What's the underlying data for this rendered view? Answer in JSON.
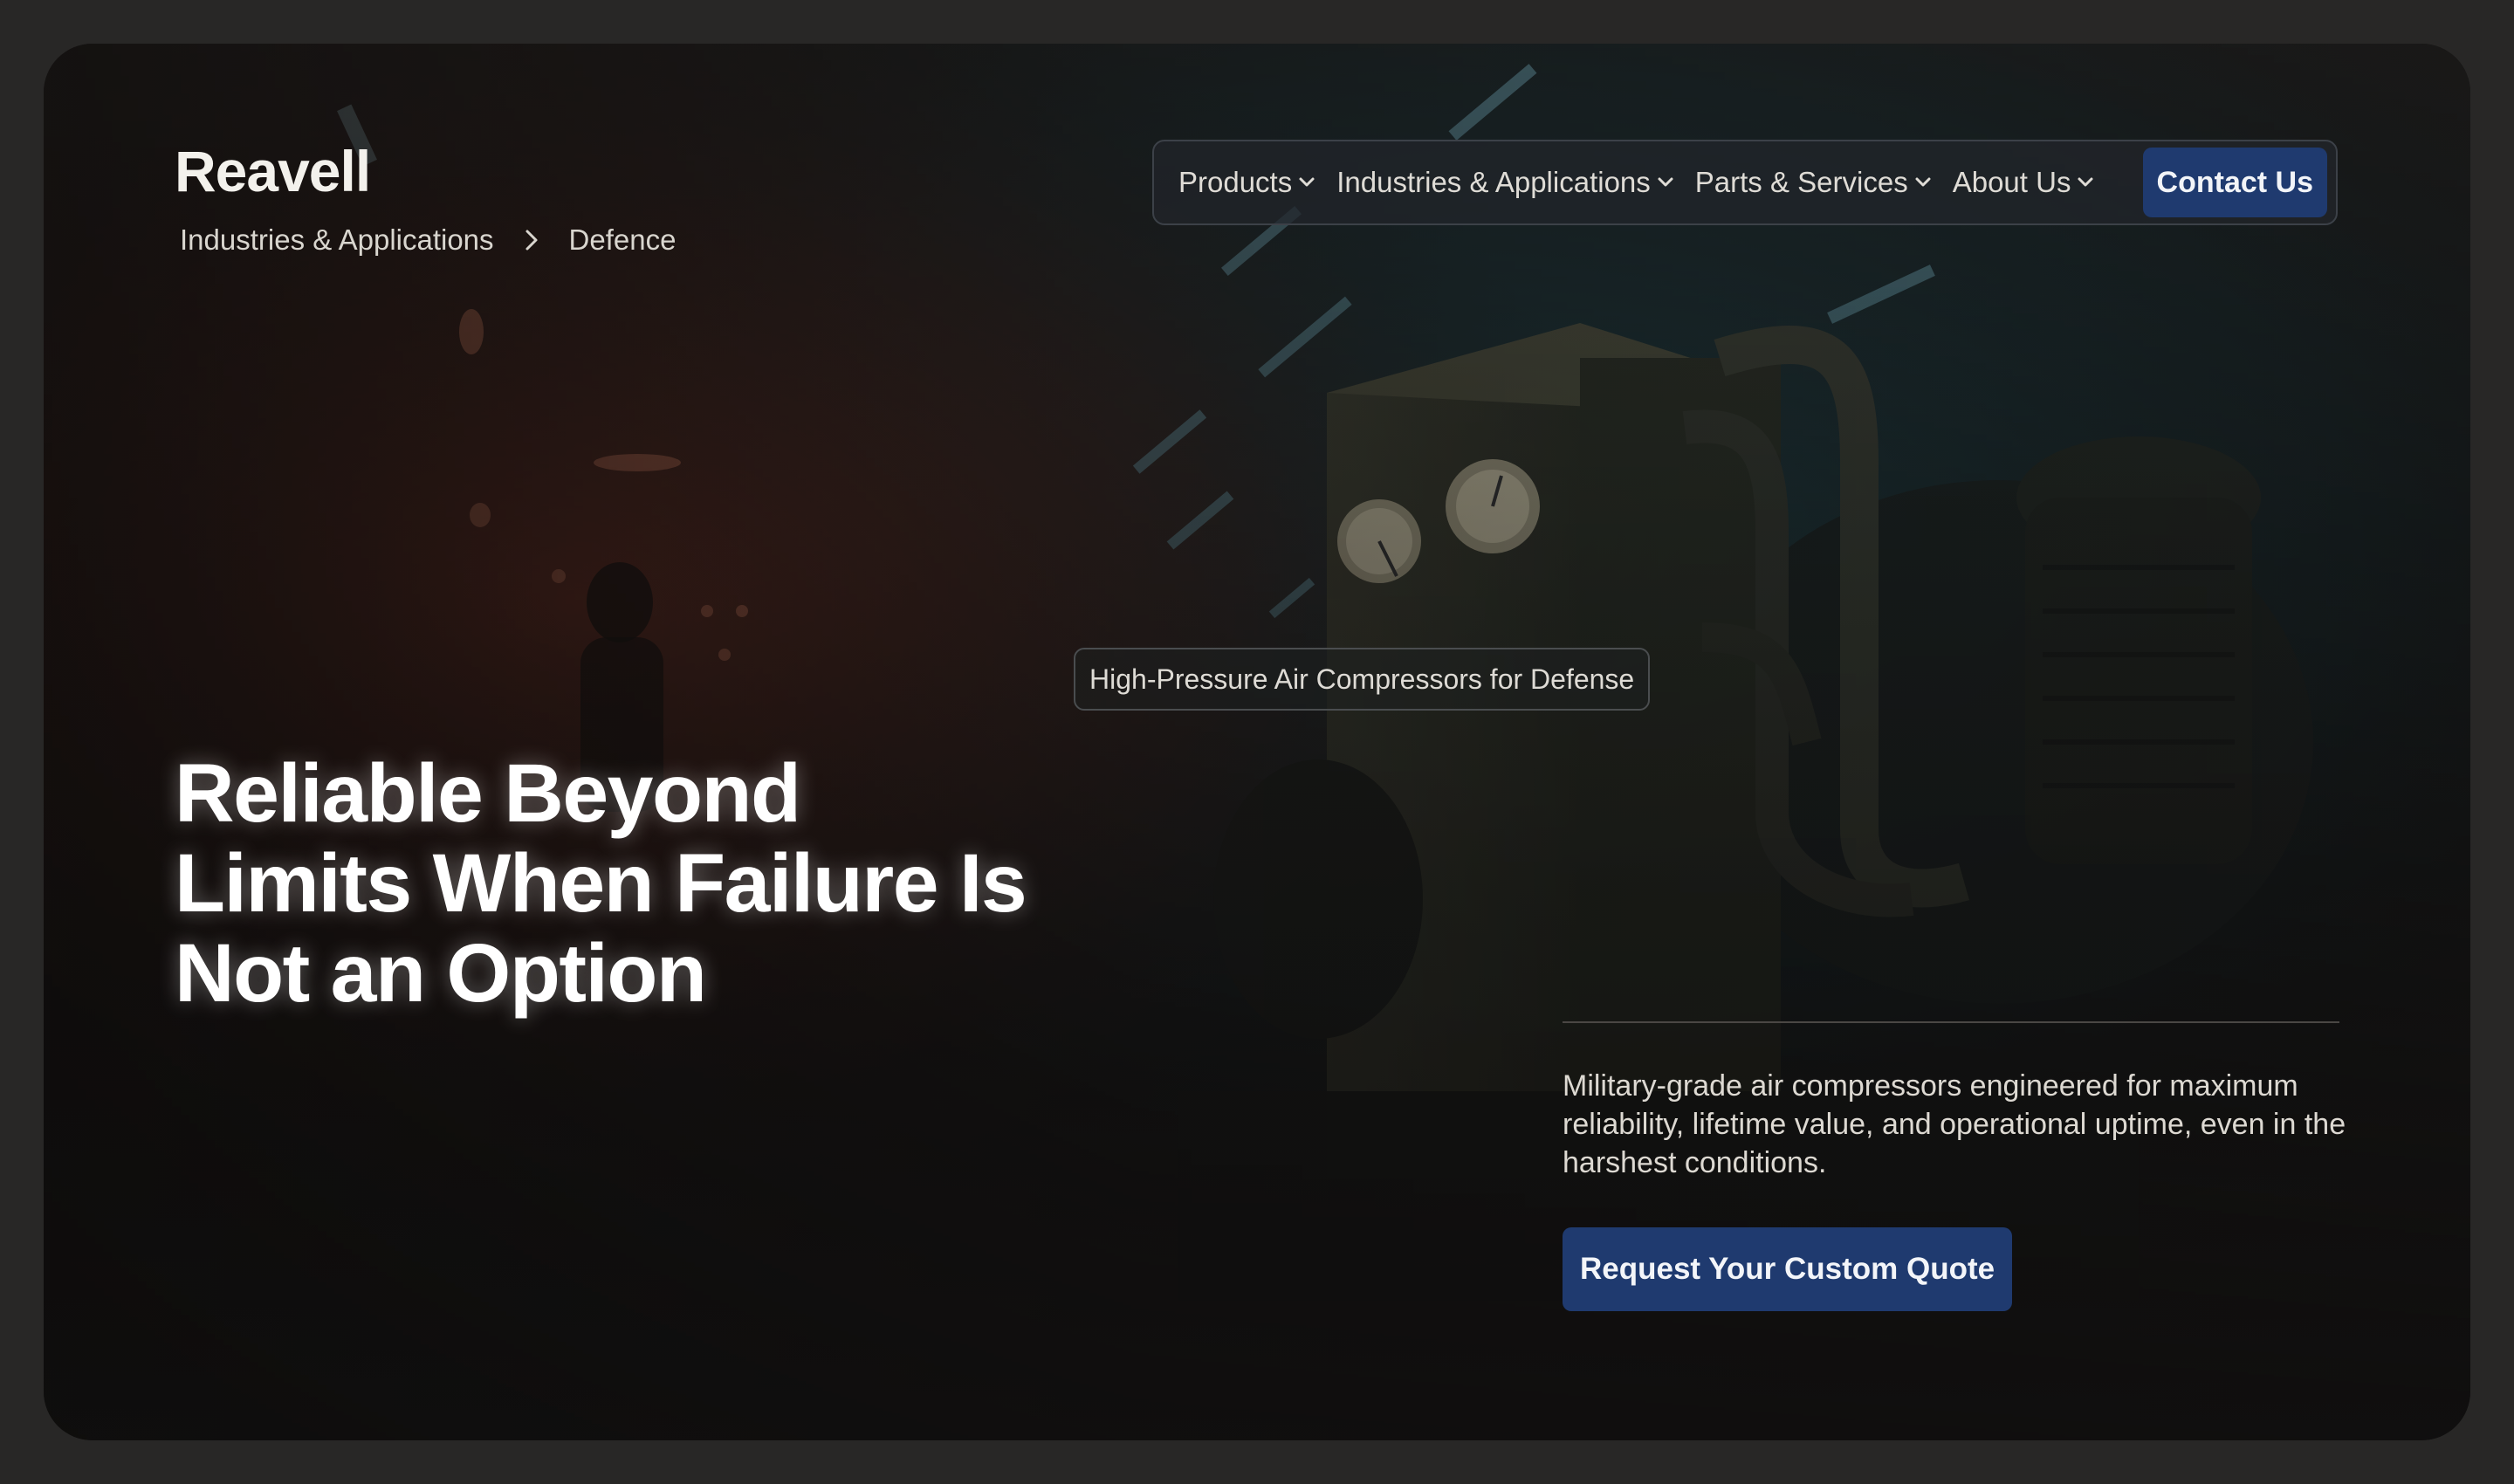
{
  "brand": {
    "logo": "Reavell"
  },
  "breadcrumb": {
    "items": [
      "Industries & Applications",
      "Defence"
    ],
    "separator_icon": "chevron-right-icon"
  },
  "nav": {
    "items": [
      {
        "label": "Products",
        "icon": "chevron-down-icon"
      },
      {
        "label": "Industries & Applications",
        "icon": "chevron-down-icon"
      },
      {
        "label": "Parts & Services",
        "icon": "chevron-down-icon"
      },
      {
        "label": "About Us",
        "icon": "chevron-down-icon"
      }
    ],
    "cta": "Contact Us"
  },
  "hero": {
    "tag": "High-Pressure Air Compressors for Defense",
    "headline": "Reliable Beyond Limits When Failure Is Not an Option",
    "description": "Military-grade air compressors engineered for maximum reliability, lifetime value, and operational uptime, even in the harshest conditions.",
    "cta": "Request Your Custom Quote"
  },
  "colors": {
    "page_background": "#282726",
    "accent_button": "#1f3a6f",
    "text_primary": "#ffffff",
    "text_secondary": "#ddd9d2"
  }
}
